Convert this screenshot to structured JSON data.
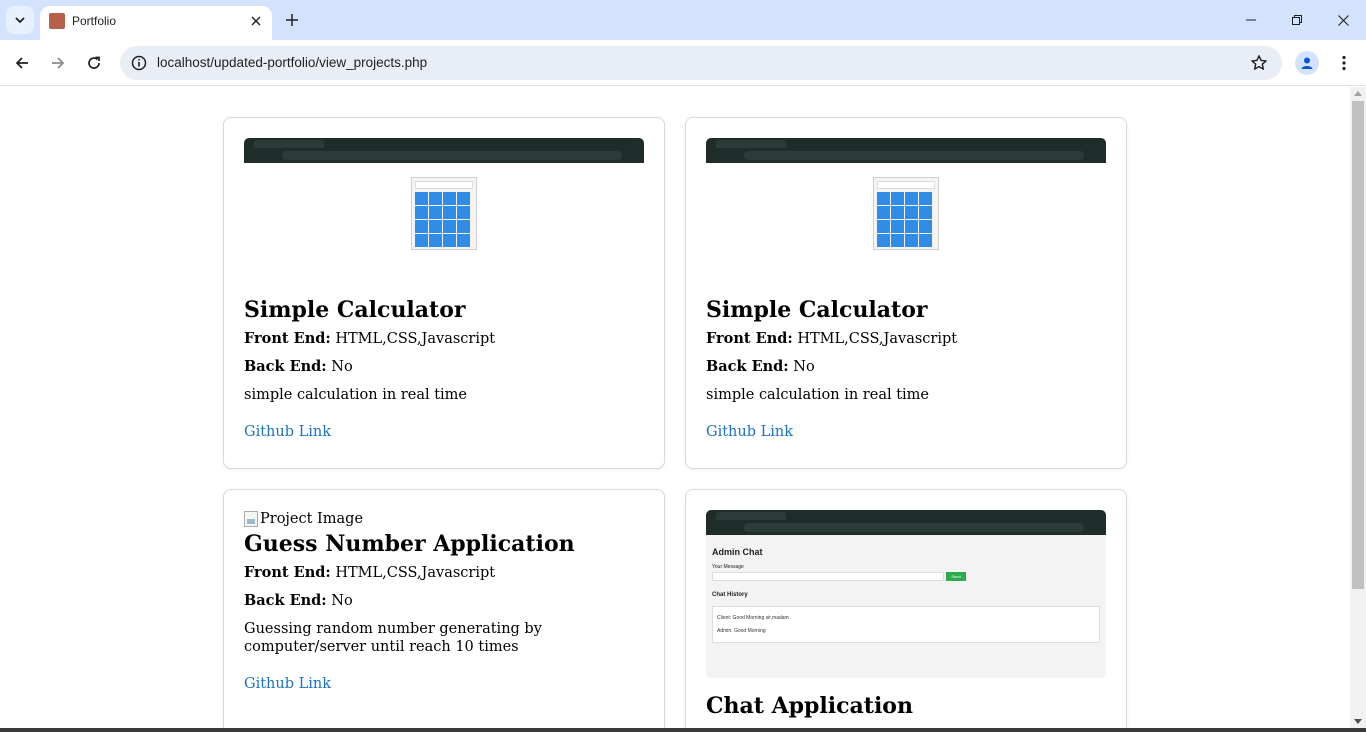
{
  "browser": {
    "tab_title": "Portfolio",
    "url": "localhost/updated-portfolio/view_projects.php"
  },
  "labels": {
    "front_end": "Front End:",
    "back_end": "Back End:",
    "link_text": "Github Link"
  },
  "projects": [
    {
      "title": "Simple Calculator",
      "front_end": "HTML,CSS,Javascript",
      "back_end": "No",
      "description": "simple calculation in real time",
      "image": "calculator-screenshot"
    },
    {
      "title": "Simple Calculator",
      "front_end": "HTML,CSS,Javascript",
      "back_end": "No",
      "description": "simple calculation in real time",
      "image": "calculator-screenshot"
    },
    {
      "title": "Guess Number Application",
      "front_end": "HTML,CSS,Javascript",
      "back_end": "No",
      "description": "Guessing random number generating by computer/server until reach 10 times",
      "image_alt": "Project Image"
    },
    {
      "title": "Chat Application",
      "image": "chat-screenshot",
      "screenshot_text": {
        "heading": "Admin Chat",
        "message_label": "Your Message",
        "send": "Send",
        "history_heading": "Chat History",
        "messages": [
          "Client: Good Morning sir,madam",
          "Admin: Good Morning"
        ]
      }
    }
  ],
  "colors": {
    "link": "#1a73c8",
    "tabbar": "#d3e3fd",
    "calc_key": "#2f8de8",
    "send_button": "#2eaa4f"
  }
}
